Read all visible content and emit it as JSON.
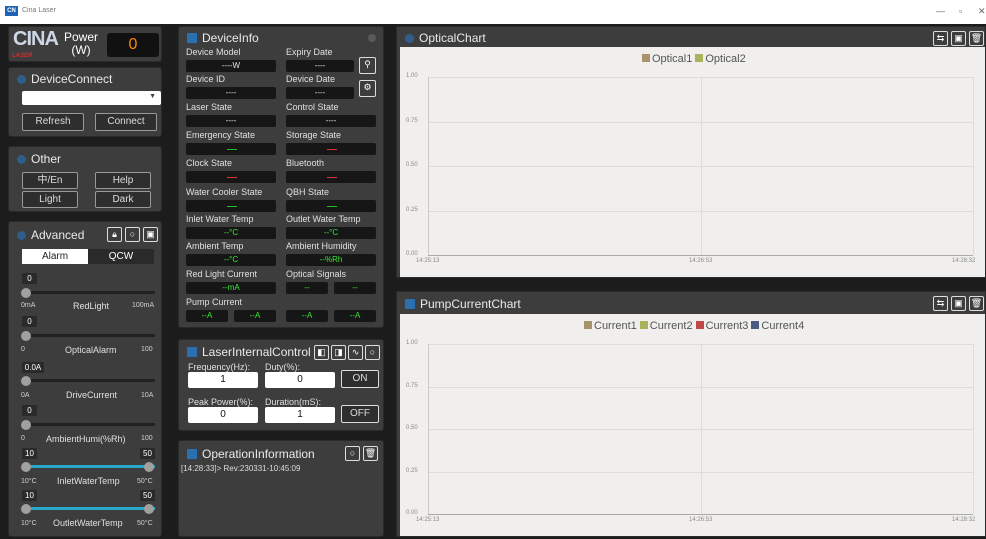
{
  "window": {
    "logo": "CN",
    "title": "Cina Laser",
    "minimize": "—",
    "maximize": "▫",
    "close": "✕"
  },
  "power": {
    "logo_top": "CINA",
    "logo_bottom": "LASER",
    "label_line1": "Power",
    "label_line2": "(W)",
    "value": "0"
  },
  "device_connect": {
    "title": "DeviceConnect",
    "select_value": "",
    "refresh": "Refresh",
    "connect": "Connect"
  },
  "other": {
    "title": "Other",
    "lang": "中/En",
    "help": "Help",
    "light": "Light",
    "dark": "Dark"
  },
  "advanced": {
    "title": "Advanced",
    "tab_alarm": "Alarm",
    "tab_qcw": "QCW",
    "sliders": [
      {
        "value": "0",
        "min": "0mA",
        "label": "RedLight",
        "max": "100mA"
      },
      {
        "value": "0",
        "min": "0",
        "label": "OpticalAlarm",
        "max": "100"
      },
      {
        "value": "0.0A",
        "min": "0A",
        "label": "DriveCurrent",
        "max": "10A"
      },
      {
        "value": "0",
        "min": "0",
        "label": "AmbientHumi(%Rh)",
        "max": "100"
      },
      {
        "value": "10",
        "value2": "50",
        "min": "10°C",
        "label": "InletWaterTemp",
        "max": "50°C"
      },
      {
        "value": "10",
        "value2": "50",
        "min": "10°C",
        "label": "OutletWaterTemp",
        "max": "50°C"
      }
    ]
  },
  "device_info": {
    "title": "DeviceInfo",
    "model_label": "Device Model",
    "model_value": "----W",
    "expiry_label": "Expiry Date",
    "expiry_value": "----",
    "id_label": "Device ID",
    "id_value": "----",
    "date_label": "Device Date",
    "date_value": "----",
    "laser_state_label": "Laser State",
    "laser_state_value": "----",
    "control_state_label": "Control State",
    "control_state_value": "----",
    "emergency_label": "Emergency State",
    "storage_label": "Storage State",
    "clock_label": "Clock State",
    "bluetooth_label": "Bluetooth",
    "water_cooler_label": "Water Cooler State",
    "qbh_label": "QBH State",
    "inlet_label": "Inlet Water Temp",
    "inlet_value": "--°C",
    "outlet_label": "Outlet Water Temp",
    "outlet_value": "--°C",
    "ambient_temp_label": "Ambient Temp",
    "ambient_temp_value": "--°C",
    "ambient_humi_label": "Ambient Humidity",
    "ambient_humi_value": "--%Rh",
    "red_light_label": "Red Light Current",
    "red_light_value": "--mA",
    "optical_signals_label": "Optical Signals",
    "optical_sig1": "--",
    "optical_sig2": "--",
    "pump_label": "Pump Current",
    "pump_values": [
      "--A",
      "--A",
      "--A",
      "--A"
    ]
  },
  "laser_internal": {
    "title": "LaserInternalControl",
    "freq_label": "Frequency(Hz):",
    "freq_value": "1",
    "duty_label": "Duty(%):",
    "duty_value": "0",
    "on": "ON",
    "peak_label": "Peak Power(%):",
    "peak_value": "0",
    "duration_label": "Duration(mS):",
    "duration_value": "1",
    "off": "OFF"
  },
  "operation": {
    "title": "OperationInformation",
    "log": "[14:28:33]> Rev:230331-10:45:09"
  },
  "optical_chart_title": "OpticalChart",
  "pump_chart_title": "PumpCurrentChart",
  "chart_data": [
    {
      "type": "line",
      "title": "",
      "legend_position": "top-center",
      "series": [
        {
          "name": "Optical1",
          "color": "#a8946a",
          "values": []
        },
        {
          "name": "Optical2",
          "color": "#a8b35a",
          "values": []
        }
      ],
      "yticks": [
        "0.00",
        "0.25",
        "0.50",
        "0.75",
        "1.00"
      ],
      "ylim": [
        0,
        1
      ],
      "xticks": [
        "14:25:13",
        "14:26:53",
        "14:28:32"
      ],
      "grid": true
    },
    {
      "type": "line",
      "title": "",
      "legend_position": "top-center",
      "series": [
        {
          "name": "Current1",
          "color": "#a8946a",
          "values": []
        },
        {
          "name": "Current2",
          "color": "#a8b35a",
          "values": []
        },
        {
          "name": "Current3",
          "color": "#c04848",
          "values": []
        },
        {
          "name": "Current4",
          "color": "#4a5b80",
          "values": []
        }
      ],
      "yticks": [
        "0.00",
        "0.25",
        "0.50",
        "0.75",
        "1.00"
      ],
      "ylim": [
        0,
        1
      ],
      "xticks": [
        "14:25:13",
        "14:26:53",
        "14:28:32"
      ],
      "grid": true
    }
  ]
}
